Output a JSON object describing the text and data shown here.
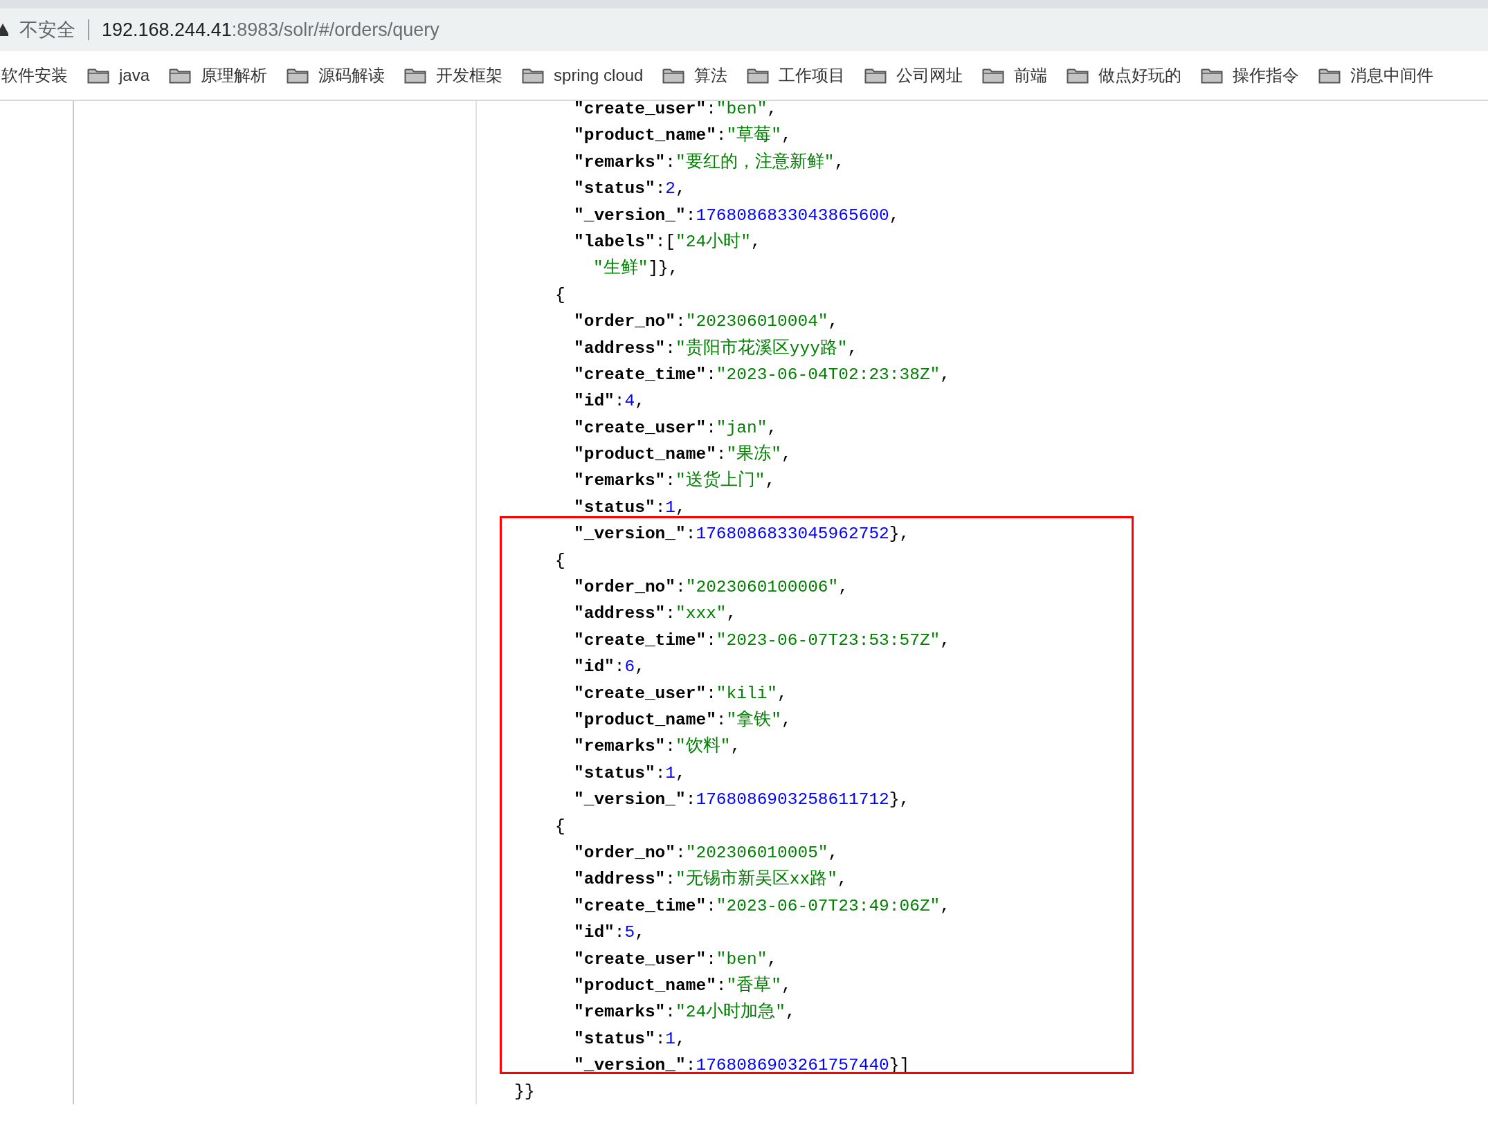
{
  "address_bar": {
    "security_label": "不安全",
    "url_host": "192.168.244.41",
    "url_path": ":8983/solr/#/orders/query"
  },
  "bookmarks": [
    {
      "label": "软件安装",
      "folder_icon": false
    },
    {
      "label": "java",
      "folder_icon": true
    },
    {
      "label": "原理解析",
      "folder_icon": true
    },
    {
      "label": "源码解读",
      "folder_icon": true
    },
    {
      "label": "开发框架",
      "folder_icon": true
    },
    {
      "label": "spring cloud",
      "folder_icon": true
    },
    {
      "label": "算法",
      "folder_icon": true
    },
    {
      "label": "工作项目",
      "folder_icon": true
    },
    {
      "label": "公司网址",
      "folder_icon": true
    },
    {
      "label": "前端",
      "folder_icon": true
    },
    {
      "label": "做点好玩的",
      "folder_icon": true
    },
    {
      "label": "操作指令",
      "folder_icon": true
    },
    {
      "label": "消息中间件",
      "folder_icon": true
    }
  ],
  "response_lines": [
    {
      "kind": "field",
      "parts": [
        {
          "kind": "key",
          "text": "\"create_user\""
        },
        {
          "kind": "punct",
          "text": ":"
        },
        {
          "kind": "string",
          "text": "\"ben\""
        },
        {
          "kind": "punct",
          "text": ","
        }
      ]
    },
    {
      "kind": "field",
      "parts": [
        {
          "kind": "key",
          "text": "\"product_name\""
        },
        {
          "kind": "punct",
          "text": ":"
        },
        {
          "kind": "string",
          "text": "\"草莓\""
        },
        {
          "kind": "punct",
          "text": ","
        }
      ]
    },
    {
      "kind": "field",
      "parts": [
        {
          "kind": "key",
          "text": "\"remarks\""
        },
        {
          "kind": "punct",
          "text": ":"
        },
        {
          "kind": "string",
          "text": "\"要红的，注意新鲜\""
        },
        {
          "kind": "punct",
          "text": ","
        }
      ]
    },
    {
      "kind": "field",
      "parts": [
        {
          "kind": "key",
          "text": "\"status\""
        },
        {
          "kind": "punct",
          "text": ":"
        },
        {
          "kind": "number",
          "text": "2"
        },
        {
          "kind": "punct",
          "text": ","
        }
      ]
    },
    {
      "kind": "field",
      "parts": [
        {
          "kind": "key",
          "text": "\"_version_\""
        },
        {
          "kind": "punct",
          "text": ":"
        },
        {
          "kind": "number",
          "text": "1768086833043865600"
        },
        {
          "kind": "punct",
          "text": ","
        }
      ]
    },
    {
      "kind": "field",
      "parts": [
        {
          "kind": "key",
          "text": "\"labels\""
        },
        {
          "kind": "punct",
          "text": ":["
        },
        {
          "kind": "string",
          "text": "\"24小时\""
        },
        {
          "kind": "punct",
          "text": ","
        }
      ]
    },
    {
      "kind": "item",
      "parts": [
        {
          "kind": "string",
          "text": "\"生鲜\""
        },
        {
          "kind": "punct",
          "text": "]},"
        }
      ]
    },
    {
      "kind": "open",
      "parts": [
        {
          "kind": "punct",
          "text": "{"
        }
      ]
    },
    {
      "kind": "field",
      "parts": [
        {
          "kind": "key",
          "text": "\"order_no\""
        },
        {
          "kind": "punct",
          "text": ":"
        },
        {
          "kind": "string",
          "text": "\"202306010004\""
        },
        {
          "kind": "punct",
          "text": ","
        }
      ]
    },
    {
      "kind": "field",
      "parts": [
        {
          "kind": "key",
          "text": "\"address\""
        },
        {
          "kind": "punct",
          "text": ":"
        },
        {
          "kind": "string",
          "text": "\"贵阳市花溪区yyy路\""
        },
        {
          "kind": "punct",
          "text": ","
        }
      ]
    },
    {
      "kind": "field",
      "parts": [
        {
          "kind": "key",
          "text": "\"create_time\""
        },
        {
          "kind": "punct",
          "text": ":"
        },
        {
          "kind": "string",
          "text": "\"2023-06-04T02:23:38Z\""
        },
        {
          "kind": "punct",
          "text": ","
        }
      ]
    },
    {
      "kind": "field",
      "parts": [
        {
          "kind": "key",
          "text": "\"id\""
        },
        {
          "kind": "punct",
          "text": ":"
        },
        {
          "kind": "number",
          "text": "4"
        },
        {
          "kind": "punct",
          "text": ","
        }
      ]
    },
    {
      "kind": "field",
      "parts": [
        {
          "kind": "key",
          "text": "\"create_user\""
        },
        {
          "kind": "punct",
          "text": ":"
        },
        {
          "kind": "string",
          "text": "\"jan\""
        },
        {
          "kind": "punct",
          "text": ","
        }
      ]
    },
    {
      "kind": "field",
      "parts": [
        {
          "kind": "key",
          "text": "\"product_name\""
        },
        {
          "kind": "punct",
          "text": ":"
        },
        {
          "kind": "string",
          "text": "\"果冻\""
        },
        {
          "kind": "punct",
          "text": ","
        }
      ]
    },
    {
      "kind": "field",
      "parts": [
        {
          "kind": "key",
          "text": "\"remarks\""
        },
        {
          "kind": "punct",
          "text": ":"
        },
        {
          "kind": "string",
          "text": "\"送货上门\""
        },
        {
          "kind": "punct",
          "text": ","
        }
      ]
    },
    {
      "kind": "field",
      "parts": [
        {
          "kind": "key",
          "text": "\"status\""
        },
        {
          "kind": "punct",
          "text": ":"
        },
        {
          "kind": "number",
          "text": "1"
        },
        {
          "kind": "punct",
          "text": ","
        }
      ]
    },
    {
      "kind": "field",
      "parts": [
        {
          "kind": "key",
          "text": "\"_version_\""
        },
        {
          "kind": "punct",
          "text": ":"
        },
        {
          "kind": "number",
          "text": "1768086833045962752"
        },
        {
          "kind": "punct",
          "text": "},"
        }
      ]
    },
    {
      "kind": "open",
      "parts": [
        {
          "kind": "punct",
          "text": "{"
        }
      ]
    },
    {
      "kind": "field",
      "parts": [
        {
          "kind": "key",
          "text": "\"order_no\""
        },
        {
          "kind": "punct",
          "text": ":"
        },
        {
          "kind": "string",
          "text": "\"2023060100006\""
        },
        {
          "kind": "punct",
          "text": ","
        }
      ]
    },
    {
      "kind": "field",
      "parts": [
        {
          "kind": "key",
          "text": "\"address\""
        },
        {
          "kind": "punct",
          "text": ":"
        },
        {
          "kind": "string",
          "text": "\"xxx\""
        },
        {
          "kind": "punct",
          "text": ","
        }
      ]
    },
    {
      "kind": "field",
      "parts": [
        {
          "kind": "key",
          "text": "\"create_time\""
        },
        {
          "kind": "punct",
          "text": ":"
        },
        {
          "kind": "string",
          "text": "\"2023-06-07T23:53:57Z\""
        },
        {
          "kind": "punct",
          "text": ","
        }
      ]
    },
    {
      "kind": "field",
      "parts": [
        {
          "kind": "key",
          "text": "\"id\""
        },
        {
          "kind": "punct",
          "text": ":"
        },
        {
          "kind": "number",
          "text": "6"
        },
        {
          "kind": "punct",
          "text": ","
        }
      ]
    },
    {
      "kind": "field",
      "parts": [
        {
          "kind": "key",
          "text": "\"create_user\""
        },
        {
          "kind": "punct",
          "text": ":"
        },
        {
          "kind": "string",
          "text": "\"kili\""
        },
        {
          "kind": "punct",
          "text": ","
        }
      ]
    },
    {
      "kind": "field",
      "parts": [
        {
          "kind": "key",
          "text": "\"product_name\""
        },
        {
          "kind": "punct",
          "text": ":"
        },
        {
          "kind": "string",
          "text": "\"拿铁\""
        },
        {
          "kind": "punct",
          "text": ","
        }
      ]
    },
    {
      "kind": "field",
      "parts": [
        {
          "kind": "key",
          "text": "\"remarks\""
        },
        {
          "kind": "punct",
          "text": ":"
        },
        {
          "kind": "string",
          "text": "\"饮料\""
        },
        {
          "kind": "punct",
          "text": ","
        }
      ]
    },
    {
      "kind": "field",
      "parts": [
        {
          "kind": "key",
          "text": "\"status\""
        },
        {
          "kind": "punct",
          "text": ":"
        },
        {
          "kind": "number",
          "text": "1"
        },
        {
          "kind": "punct",
          "text": ","
        }
      ]
    },
    {
      "kind": "field",
      "parts": [
        {
          "kind": "key",
          "text": "\"_version_\""
        },
        {
          "kind": "punct",
          "text": ":"
        },
        {
          "kind": "number",
          "text": "1768086903258611712"
        },
        {
          "kind": "punct",
          "text": "},"
        }
      ]
    },
    {
      "kind": "open",
      "parts": [
        {
          "kind": "punct",
          "text": "{"
        }
      ]
    },
    {
      "kind": "field",
      "parts": [
        {
          "kind": "key",
          "text": "\"order_no\""
        },
        {
          "kind": "punct",
          "text": ":"
        },
        {
          "kind": "string",
          "text": "\"202306010005\""
        },
        {
          "kind": "punct",
          "text": ","
        }
      ]
    },
    {
      "kind": "field",
      "parts": [
        {
          "kind": "key",
          "text": "\"address\""
        },
        {
          "kind": "punct",
          "text": ":"
        },
        {
          "kind": "string",
          "text": "\"无锡市新吴区xx路\""
        },
        {
          "kind": "punct",
          "text": ","
        }
      ]
    },
    {
      "kind": "field",
      "parts": [
        {
          "kind": "key",
          "text": "\"create_time\""
        },
        {
          "kind": "punct",
          "text": ":"
        },
        {
          "kind": "string",
          "text": "\"2023-06-07T23:49:06Z\""
        },
        {
          "kind": "punct",
          "text": ","
        }
      ]
    },
    {
      "kind": "field",
      "parts": [
        {
          "kind": "key",
          "text": "\"id\""
        },
        {
          "kind": "punct",
          "text": ":"
        },
        {
          "kind": "number",
          "text": "5"
        },
        {
          "kind": "punct",
          "text": ","
        }
      ]
    },
    {
      "kind": "field",
      "parts": [
        {
          "kind": "key",
          "text": "\"create_user\""
        },
        {
          "kind": "punct",
          "text": ":"
        },
        {
          "kind": "string",
          "text": "\"ben\""
        },
        {
          "kind": "punct",
          "text": ","
        }
      ]
    },
    {
      "kind": "field",
      "parts": [
        {
          "kind": "key",
          "text": "\"product_name\""
        },
        {
          "kind": "punct",
          "text": ":"
        },
        {
          "kind": "string",
          "text": "\"香草\""
        },
        {
          "kind": "punct",
          "text": ","
        }
      ]
    },
    {
      "kind": "field",
      "parts": [
        {
          "kind": "key",
          "text": "\"remarks\""
        },
        {
          "kind": "punct",
          "text": ":"
        },
        {
          "kind": "string",
          "text": "\"24小时加急\""
        },
        {
          "kind": "punct",
          "text": ","
        }
      ]
    },
    {
      "kind": "field",
      "parts": [
        {
          "kind": "key",
          "text": "\"status\""
        },
        {
          "kind": "punct",
          "text": ":"
        },
        {
          "kind": "number",
          "text": "1"
        },
        {
          "kind": "punct",
          "text": ","
        }
      ]
    },
    {
      "kind": "field",
      "parts": [
        {
          "kind": "key",
          "text": "\"_version_\""
        },
        {
          "kind": "punct",
          "text": ":"
        },
        {
          "kind": "number",
          "text": "1768086903261757440"
        },
        {
          "kind": "punct",
          "text": "}]"
        }
      ]
    },
    {
      "kind": "close",
      "parts": [
        {
          "kind": "punct",
          "text": "}}"
        }
      ]
    }
  ]
}
